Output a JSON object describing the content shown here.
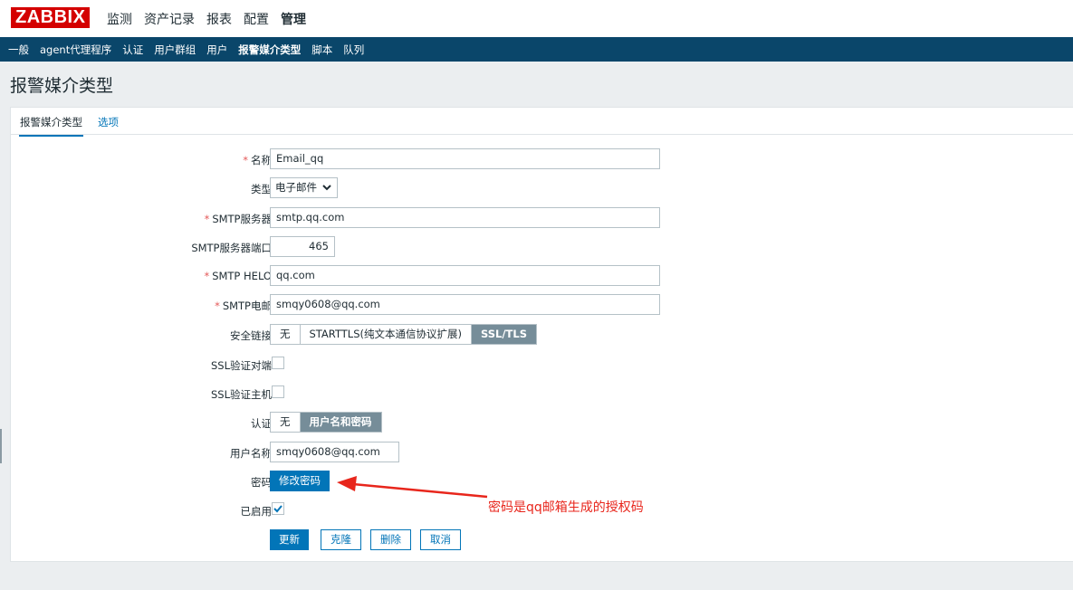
{
  "brand": {
    "logo_text": "ZABBIX",
    "color": "#d40000"
  },
  "main_menu": [
    {
      "label": "监测"
    },
    {
      "label": "资产记录"
    },
    {
      "label": "报表"
    },
    {
      "label": "配置"
    },
    {
      "label": "管理",
      "selected": true
    }
  ],
  "sub_menu": [
    {
      "label": "一般"
    },
    {
      "label": "agent代理程序"
    },
    {
      "label": "认证"
    },
    {
      "label": "用户群组"
    },
    {
      "label": "用户"
    },
    {
      "label": "报警媒介类型",
      "selected": true
    },
    {
      "label": "脚本"
    },
    {
      "label": "队列"
    }
  ],
  "page": {
    "title": "报警媒介类型"
  },
  "tabs": {
    "active": "报警媒介类型",
    "other": "选项"
  },
  "form": {
    "name": {
      "label": "名称",
      "value": "Email_qq",
      "required": "*"
    },
    "type": {
      "label": "类型",
      "value": "电子邮件"
    },
    "smtp_server": {
      "label": "SMTP服务器",
      "value": "smtp.qq.com",
      "required": "*"
    },
    "smtp_port": {
      "label": "SMTP服务器端口",
      "value": "465"
    },
    "smtp_helo": {
      "label": "SMTP HELO",
      "value": "qq.com",
      "required": "*"
    },
    "smtp_email": {
      "label": "SMTP电邮",
      "value": "smqy0608@qq.com",
      "required": "*"
    },
    "security": {
      "label": "安全链接",
      "options": [
        "无",
        "STARTTLS(纯文本通信协议扩展)",
        "SSL/TLS"
      ],
      "selected": "SSL/TLS"
    },
    "ssl_verify_peer": {
      "label": "SSL验证对端",
      "checked": false
    },
    "ssl_verify_host": {
      "label": "SSL验证主机",
      "checked": false
    },
    "auth": {
      "label": "认证",
      "options": [
        "无",
        "用户名和密码"
      ],
      "selected": "用户名和密码"
    },
    "username": {
      "label": "用户名称",
      "value": "smqy0608@qq.com"
    },
    "password": {
      "label": "密码",
      "button": "修改密码"
    },
    "enabled": {
      "label": "已启用",
      "checked": true
    }
  },
  "actions": {
    "update": "更新",
    "clone": "克隆",
    "delete": "删除",
    "cancel": "取消"
  },
  "annotation": {
    "text": "密码是qq邮箱生成的授权码",
    "color": "#e8261c"
  },
  "colors": {
    "accent": "#0275b8",
    "nav_bg": "#0a466a",
    "segment_on": "#768d99",
    "required": "#e45959"
  }
}
